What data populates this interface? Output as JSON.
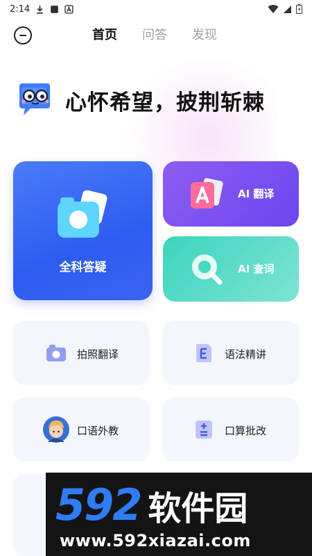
{
  "status_bar": {
    "time": "2:14",
    "icons": [
      "download-icon",
      "square-icon",
      "a-badge-icon",
      "wifi-icon",
      "signal-icon",
      "battery-icon"
    ]
  },
  "nav": {
    "tabs": [
      {
        "label": "首页",
        "active": true
      },
      {
        "label": "问答",
        "active": false
      },
      {
        "label": "发现",
        "active": false
      }
    ]
  },
  "hero": {
    "slogan": "心怀希望，披荆斩棘"
  },
  "features": {
    "main": {
      "label": "全科答疑",
      "icon": "camera-icon",
      "color": "#3a63f3"
    },
    "translate": {
      "label": "AI 翻译",
      "icon": "ai-translate-icon",
      "color": "#7b52f1"
    },
    "lookup": {
      "label": "AI 查词",
      "icon": "magnifier-icon",
      "color": "#4fd8c3"
    }
  },
  "tools": [
    {
      "label": "拍照翻译",
      "icon": "camera-icon"
    },
    {
      "label": "语法精讲",
      "icon": "grammar-e-icon"
    },
    {
      "label": "口语外教",
      "icon": "tutor-avatar-icon"
    },
    {
      "label": "口算批改",
      "icon": "plus-minus-icon"
    }
  ],
  "watermark": {
    "number": "592",
    "brand": "软件园",
    "url": "www.592xiazai.com"
  }
}
